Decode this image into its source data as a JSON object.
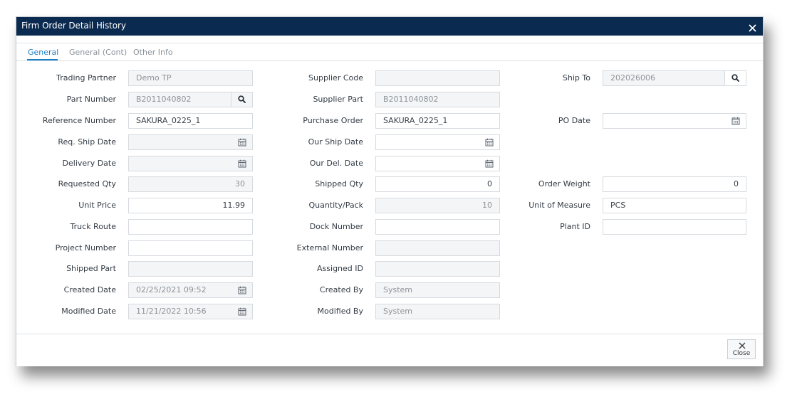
{
  "dialog": {
    "title": "Firm Order Detail History",
    "close_label": "Close"
  },
  "tabs": [
    {
      "label": "General",
      "active": true
    },
    {
      "label": "General (Cont)",
      "active": false
    },
    {
      "label": "Other Info",
      "active": false
    }
  ],
  "fields": {
    "trading_partner": {
      "label": "Trading Partner",
      "value": "Demo TP"
    },
    "part_number": {
      "label": "Part Number",
      "value": "B2011040802"
    },
    "reference_number": {
      "label": "Reference Number",
      "value": "SAKURA_0225_1"
    },
    "req_ship_date": {
      "label": "Req. Ship Date",
      "value": ""
    },
    "delivery_date": {
      "label": "Delivery Date",
      "value": ""
    },
    "requested_qty": {
      "label": "Requested Qty",
      "value": "30"
    },
    "unit_price": {
      "label": "Unit Price",
      "value": "11.99"
    },
    "truck_route": {
      "label": "Truck Route",
      "value": ""
    },
    "project_number": {
      "label": "Project Number",
      "value": ""
    },
    "shipped_part": {
      "label": "Shipped Part",
      "value": ""
    },
    "created_date": {
      "label": "Created Date",
      "value": "02/25/2021 09:52"
    },
    "modified_date": {
      "label": "Modified Date",
      "value": "11/21/2022 10:56"
    },
    "supplier_code": {
      "label": "Supplier Code",
      "value": ""
    },
    "supplier_part": {
      "label": "Supplier Part",
      "value": "B2011040802"
    },
    "purchase_order": {
      "label": "Purchase Order",
      "value": "SAKURA_0225_1"
    },
    "our_ship_date": {
      "label": "Our Ship Date",
      "value": ""
    },
    "our_del_date": {
      "label": "Our Del. Date",
      "value": ""
    },
    "shipped_qty": {
      "label": "Shipped Qty",
      "value": "0"
    },
    "quantity_pack": {
      "label": "Quantity/Pack",
      "value": "10"
    },
    "dock_number": {
      "label": "Dock Number",
      "value": ""
    },
    "external_number": {
      "label": "External Number",
      "value": ""
    },
    "assigned_id": {
      "label": "Assigned ID",
      "value": ""
    },
    "created_by": {
      "label": "Created By",
      "value": "System"
    },
    "modified_by": {
      "label": "Modified By",
      "value": "System"
    },
    "ship_to": {
      "label": "Ship To",
      "value": "202026006"
    },
    "po_date": {
      "label": "PO Date",
      "value": ""
    },
    "order_weight": {
      "label": "Order Weight",
      "value": "0"
    },
    "unit_of_measure": {
      "label": "Unit of Measure",
      "value": "PCS"
    },
    "plant_id": {
      "label": "Plant ID",
      "value": ""
    }
  },
  "colors": {
    "title_bar": "#0b2a4f",
    "accent": "#1b7dc4",
    "readonly_bg": "#f4f5f6",
    "border": "#d6dbe0"
  },
  "icons": {
    "search": "search-icon",
    "calendar": "calendar-icon",
    "close": "close-icon"
  }
}
